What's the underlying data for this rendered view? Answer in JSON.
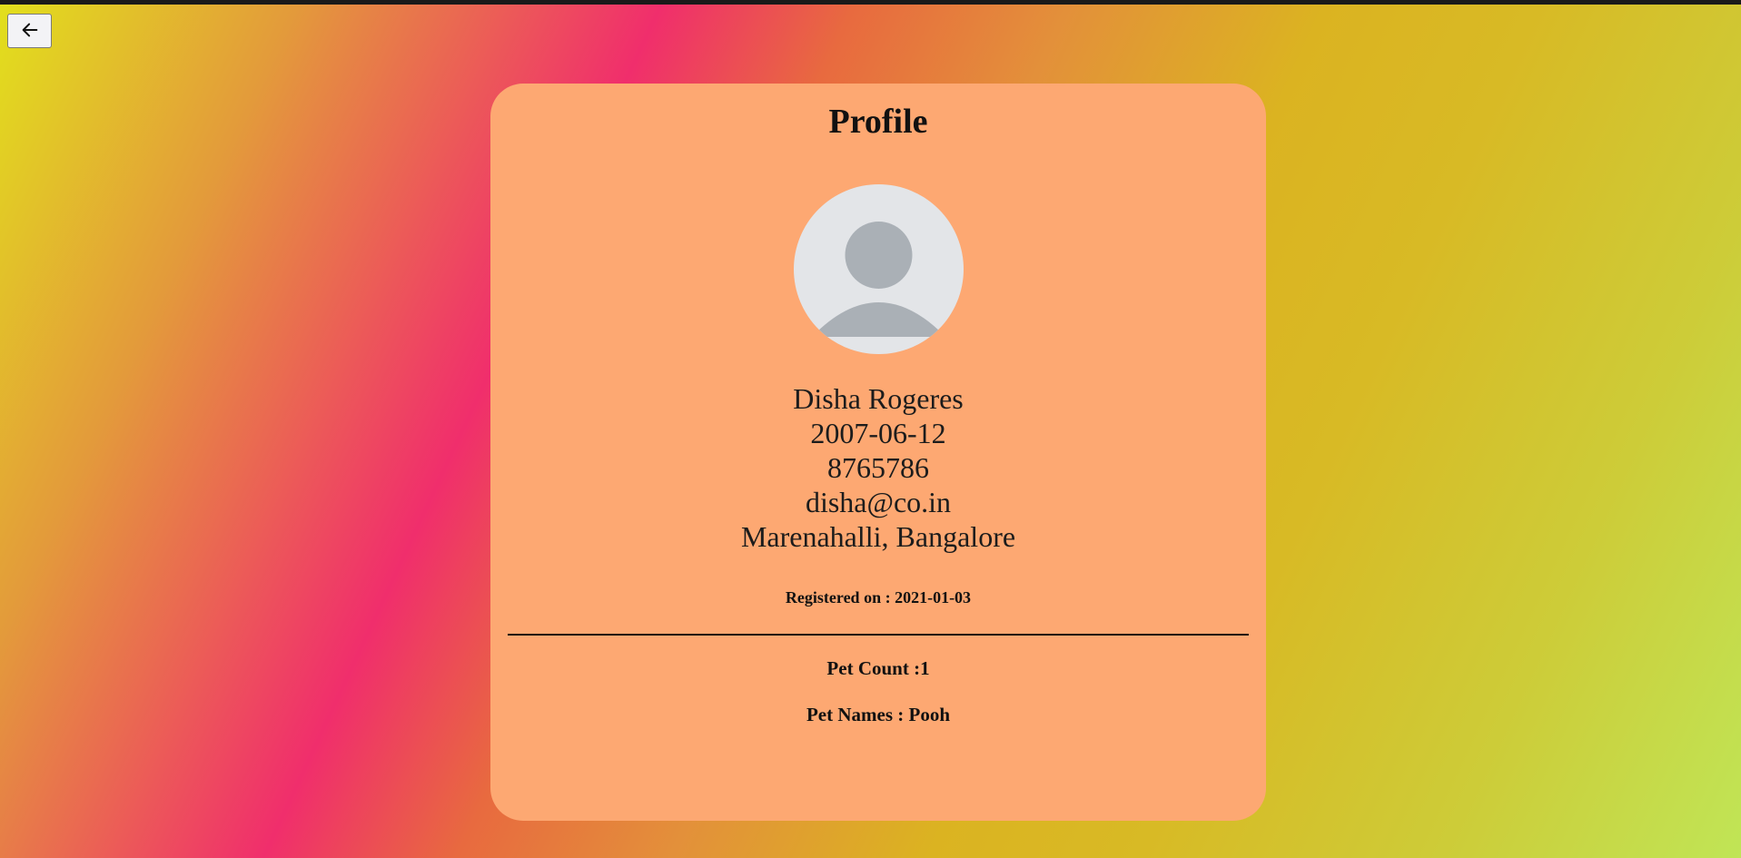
{
  "header": {
    "back_icon": "arrow-left-icon"
  },
  "profile": {
    "title": "Profile",
    "avatar_icon": "user-avatar-icon",
    "name": "Disha Rogeres",
    "dob": "2007-06-12",
    "phone": "8765786",
    "email": "disha@co.in",
    "address": "Marenahalli, Bangalore",
    "registered": "Registered on : 2021-01-03",
    "pet_count": "Pet Count :1",
    "pet_names": "Pet Names : Pooh"
  },
  "colors": {
    "card": "#fda872",
    "avatar_bg": "#e3e5e8",
    "avatar_fg": "#aab0b6"
  }
}
